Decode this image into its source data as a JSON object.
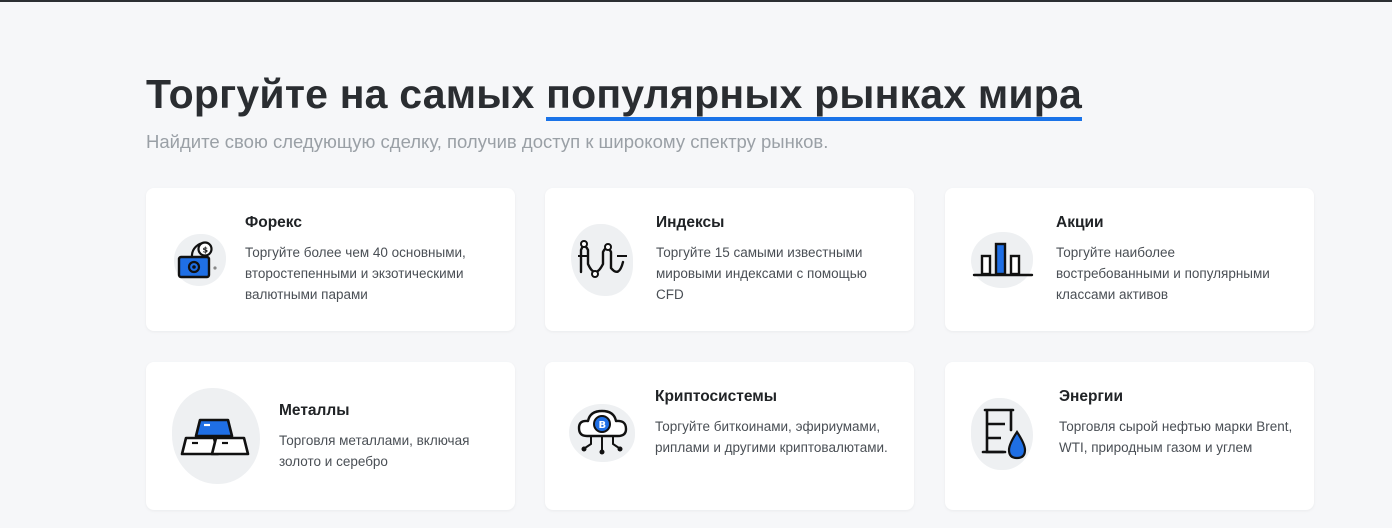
{
  "header": {
    "title_prefix": "Торгуйте на самых ",
    "title_highlight": "популярных рынках мира",
    "subtitle": "Найдите свою следующую сделку, получив доступ к широкому спектру рынков."
  },
  "cards": [
    {
      "title": "Форекс",
      "description": "Торгуйте более чем 40 основными, второстепенными и экзотическими валютными парами",
      "icon": "money-cash-icon"
    },
    {
      "title": "Индексы",
      "description": "Торгуйте 15 самыми известными мировыми индексами с помощью CFD",
      "icon": "index-chart-icon"
    },
    {
      "title": "Акции",
      "description": "Торгуйте наиболее востребованными и популярными классами активов",
      "icon": "bar-chart-icon"
    },
    {
      "title": "Металлы",
      "description": "Торговля металлами, включая золото и серебро",
      "icon": "gold-bars-icon"
    },
    {
      "title": "Криптосистемы",
      "description": "Торгуйте биткоинами, эфириумами, риплами и другими криптовалютами.",
      "icon": "crypto-cloud-icon"
    },
    {
      "title": "Энергии",
      "description": "Торговля сырой нефтью марки Brent, WTI, природным газом и углем",
      "icon": "oil-barrel-icon"
    }
  ],
  "colors": {
    "accent": "#1a73e8",
    "icon_blue": "#1f6fe5",
    "background": "#f6f7f9",
    "card": "#ffffff"
  }
}
